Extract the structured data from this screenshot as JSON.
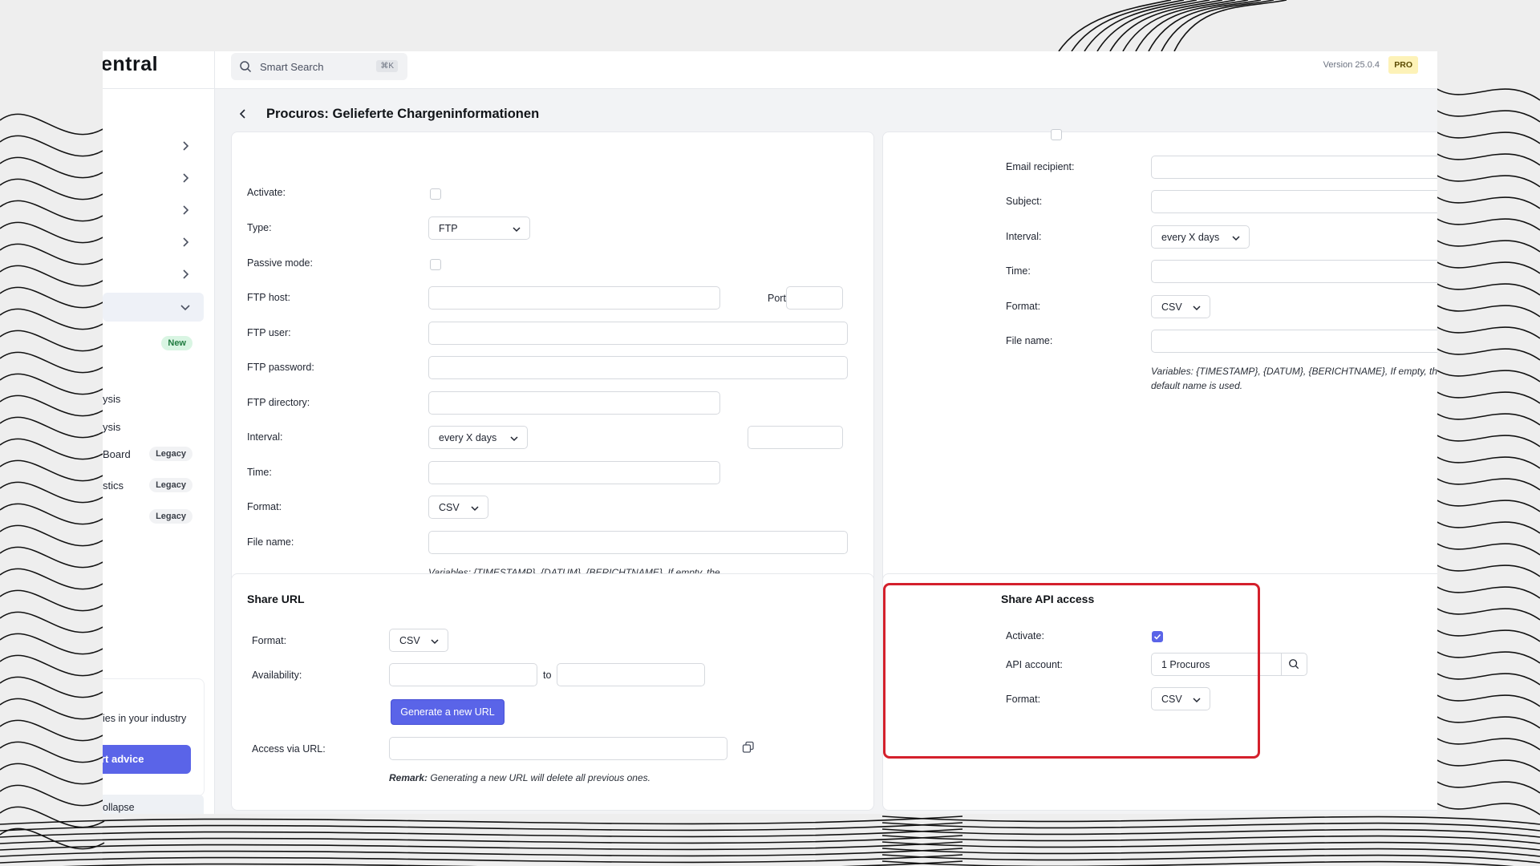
{
  "sidebar": {
    "logo_text": "entral",
    "items": [
      {
        "label": "",
        "badge": ""
      },
      {
        "label": "",
        "badge": ""
      },
      {
        "label": "",
        "badge": ""
      },
      {
        "label": "",
        "badge": ""
      },
      {
        "label": "",
        "badge": ""
      },
      {
        "label": "",
        "badge": ""
      }
    ],
    "new_badge": "New",
    "sub_items": [
      {
        "label": "ysis",
        "badge": ""
      },
      {
        "label": "ysis",
        "badge": ""
      },
      {
        "label": "Board",
        "badge": "Legacy"
      },
      {
        "label": "stics",
        "badge": "Legacy"
      },
      {
        "label": "",
        "badge": "Legacy"
      }
    ],
    "help_text": "ies in your industry",
    "help_button": "rt advice",
    "collapse_label": "ollapse"
  },
  "topbar": {
    "search_placeholder": "Smart Search",
    "shortcut": "⌘K",
    "version": "Version 25.0.4",
    "plan_badge": "PRO"
  },
  "page": {
    "title": "Procuros: Gelieferte Chargeninformationen"
  },
  "ftp_panel": {
    "activate_label": "Activate:",
    "type_label": "Type:",
    "type_value": "FTP",
    "passive_label": "Passive mode:",
    "host_label": "FTP host:",
    "port_label": "Port:",
    "user_label": "FTP user:",
    "password_label": "FTP password:",
    "directory_label": "FTP directory:",
    "interval_label": "Interval:",
    "interval_value": "every X days",
    "time_label": "Time:",
    "format_label": "Format:",
    "format_value": "CSV",
    "filename_label": "File name:",
    "hint": "Variables: {TIMESTAMP}, {DATUM}, {BERICHTNAME}, If empty, the default name is used."
  },
  "email_panel": {
    "recipient_label": "Email recipient:",
    "subject_label": "Subject:",
    "interval_label": "Interval:",
    "interval_value": "every X days",
    "time_label": "Time:",
    "format_label": "Format:",
    "format_value": "CSV",
    "filename_label": "File name:",
    "hint": "Variables: {TIMESTAMP}, {DATUM}, {BERICHTNAME}, If empty, the default name is used."
  },
  "share_url": {
    "title": "Share URL",
    "format_label": "Format:",
    "format_value": "CSV",
    "availability_label": "Availability:",
    "to_label": "to",
    "generate_button": "Generate a new URL",
    "access_label": "Access via URL:",
    "remark_bold": "Remark:",
    "remark_text": "Generating a new URL will delete all previous ones."
  },
  "share_api": {
    "title": "Share API access",
    "activate_label": "Activate:",
    "activate_checked": true,
    "account_label": "API account:",
    "account_value": "1 Procuros",
    "format_label": "Format:",
    "format_value": "CSV"
  },
  "colors": {
    "accent": "#5a64e8",
    "highlight": "#d4202c",
    "new_badge": "#d9f5e3",
    "pro_badge": "#fdf2b8"
  }
}
